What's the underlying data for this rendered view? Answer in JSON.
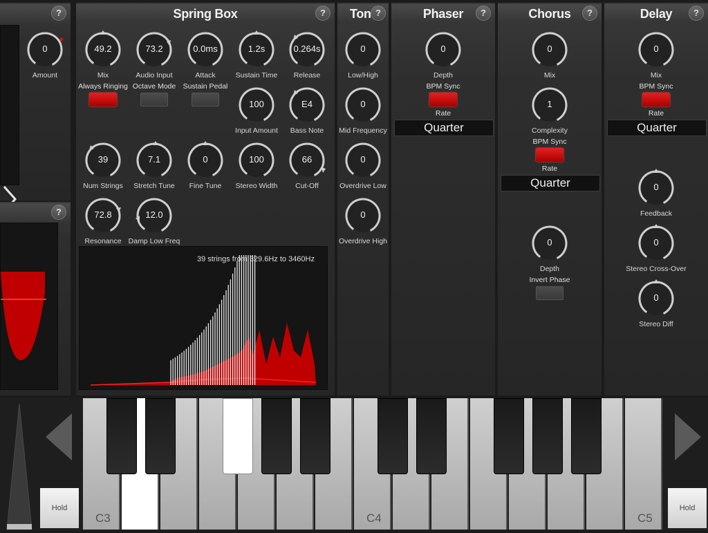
{
  "help_label": "?",
  "left_panel": {
    "amount": {
      "label": "Amount",
      "value": "0"
    }
  },
  "spring_box": {
    "title": "Spring Box",
    "knobs": {
      "mix": {
        "label": "Mix",
        "value": "49.2"
      },
      "audio_input": {
        "label": "Audio Input",
        "value": "73.2"
      },
      "attack": {
        "label": "Attack",
        "value": "0.0ms"
      },
      "sustain_time": {
        "label": "Sustain Time",
        "value": "1.2s"
      },
      "release": {
        "label": "Release",
        "value": "0.264s"
      },
      "input_amount": {
        "label": "Input Amount",
        "value": "100"
      },
      "bass_note": {
        "label": "Bass Note",
        "value": "E4"
      },
      "num_strings": {
        "label": "Num Strings",
        "value": "39"
      },
      "stretch_tune": {
        "label": "Stretch Tune",
        "value": "7.1"
      },
      "fine_tune": {
        "label": "Fine Tune",
        "value": "0"
      },
      "stereo_width": {
        "label": "Stereo Width",
        "value": "100"
      },
      "cut_off": {
        "label": "Cut-Off",
        "value": "66"
      },
      "resonance": {
        "label": "Resonance",
        "value": "72.8"
      },
      "damp_low_freq": {
        "label": "Damp Low Freq",
        "value": "12.0"
      }
    },
    "toggles": {
      "always_ringing": {
        "label": "Always Ringing",
        "on": true
      },
      "octave_mode": {
        "label": "Octave Mode",
        "on": false
      },
      "sustain_pedal": {
        "label": "Sustain Pedal",
        "on": false
      }
    },
    "display_text": "39 strings from 329.6Hz to 3460Hz"
  },
  "tone": {
    "title": "Tone",
    "knobs": {
      "low_high": {
        "label": "Low/High",
        "value": "0"
      },
      "mid_frequency": {
        "label": "Mid Frequency",
        "value": "0"
      },
      "overdrive_low": {
        "label": "Overdrive Low",
        "value": "0"
      },
      "overdrive_high": {
        "label": "Overdrive High",
        "value": "0"
      }
    }
  },
  "phaser": {
    "title": "Phaser",
    "depth": {
      "label": "Depth",
      "value": "0"
    },
    "bpm_sync": {
      "label": "BPM Sync",
      "on": true
    },
    "rate": {
      "label": "Rate",
      "value": "Quarter"
    }
  },
  "chorus": {
    "title": "Chorus",
    "mix": {
      "label": "Mix",
      "value": "0"
    },
    "complexity": {
      "label": "Complexity",
      "value": "1"
    },
    "bpm_sync": {
      "label": "BPM Sync",
      "on": true
    },
    "rate": {
      "label": "Rate",
      "value": "Quarter"
    },
    "depth": {
      "label": "Depth",
      "value": "0"
    },
    "invert_phase": {
      "label": "Invert Phase",
      "on": false
    }
  },
  "delay": {
    "title": "Delay",
    "mix": {
      "label": "Mix",
      "value": "0"
    },
    "bpm_sync": {
      "label": "BPM Sync",
      "on": true
    },
    "rate": {
      "label": "Rate",
      "value": "Quarter"
    },
    "feedback": {
      "label": "Feedback",
      "value": "0"
    },
    "stereo_cross_over": {
      "label": "Stereo Cross-Over",
      "value": "0"
    },
    "stereo_diff": {
      "label": "Stereo Diff",
      "value": "0"
    }
  },
  "keyboard": {
    "labels": {
      "c3": "C3",
      "c4": "C4",
      "c5": "C5"
    },
    "hold_left": "Hold",
    "hold_right": "Hold"
  },
  "colors": {
    "accent_red": "#e01010",
    "panel_bg": "#2a2a2a",
    "knob_ring": "#d0d0d0"
  }
}
